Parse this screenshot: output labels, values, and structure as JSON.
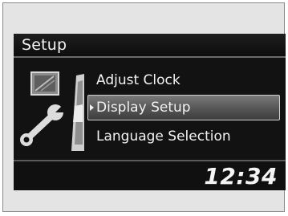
{
  "screen": {
    "title": "Setup",
    "menu": {
      "items": [
        {
          "label": "Adjust Clock"
        },
        {
          "label": "Display Setup",
          "selected": true
        },
        {
          "label": "Language Selection"
        }
      ]
    },
    "clock": "12:34",
    "icons": [
      "setup-display-icon",
      "wrench-icon",
      "scrollbar-icon"
    ]
  },
  "colors": {
    "screen_bg": "#121212",
    "text": "#f2f2f2",
    "selection": "#5a5a5a",
    "frame_bg": "#e4e4e4"
  }
}
